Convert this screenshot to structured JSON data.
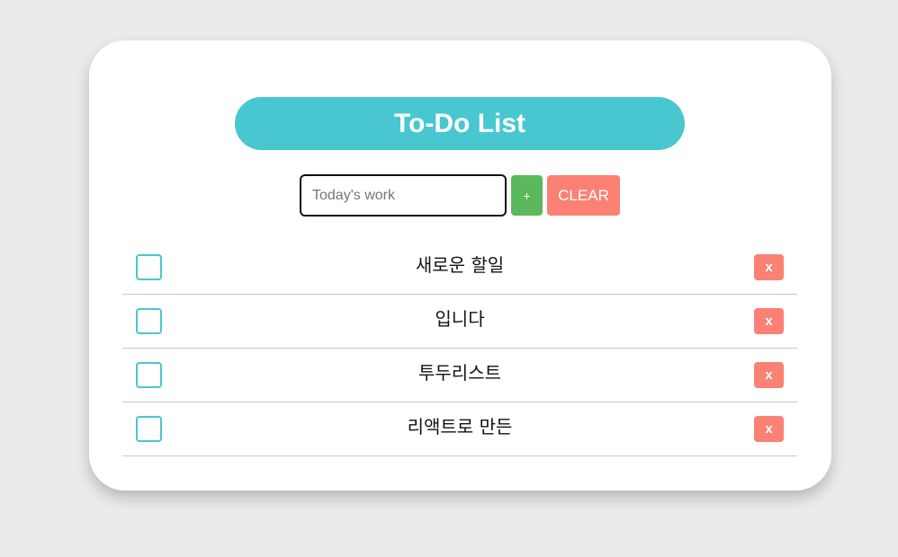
{
  "header": {
    "title": "To-Do List"
  },
  "form": {
    "placeholder": "Today's work",
    "value": "",
    "add_label": "+",
    "clear_label": "CLEAR"
  },
  "todos": [
    {
      "text": "새로운 할일",
      "checked": false,
      "delete_label": "x"
    },
    {
      "text": "입니다",
      "checked": false,
      "delete_label": "x"
    },
    {
      "text": "투두리스트",
      "checked": false,
      "delete_label": "x"
    },
    {
      "text": "리액트로 만든",
      "checked": false,
      "delete_label": "x"
    }
  ],
  "colors": {
    "accent": "#48c7d0",
    "add": "#5cb85c",
    "danger": "#fa8173",
    "background": "#ebebeb"
  }
}
